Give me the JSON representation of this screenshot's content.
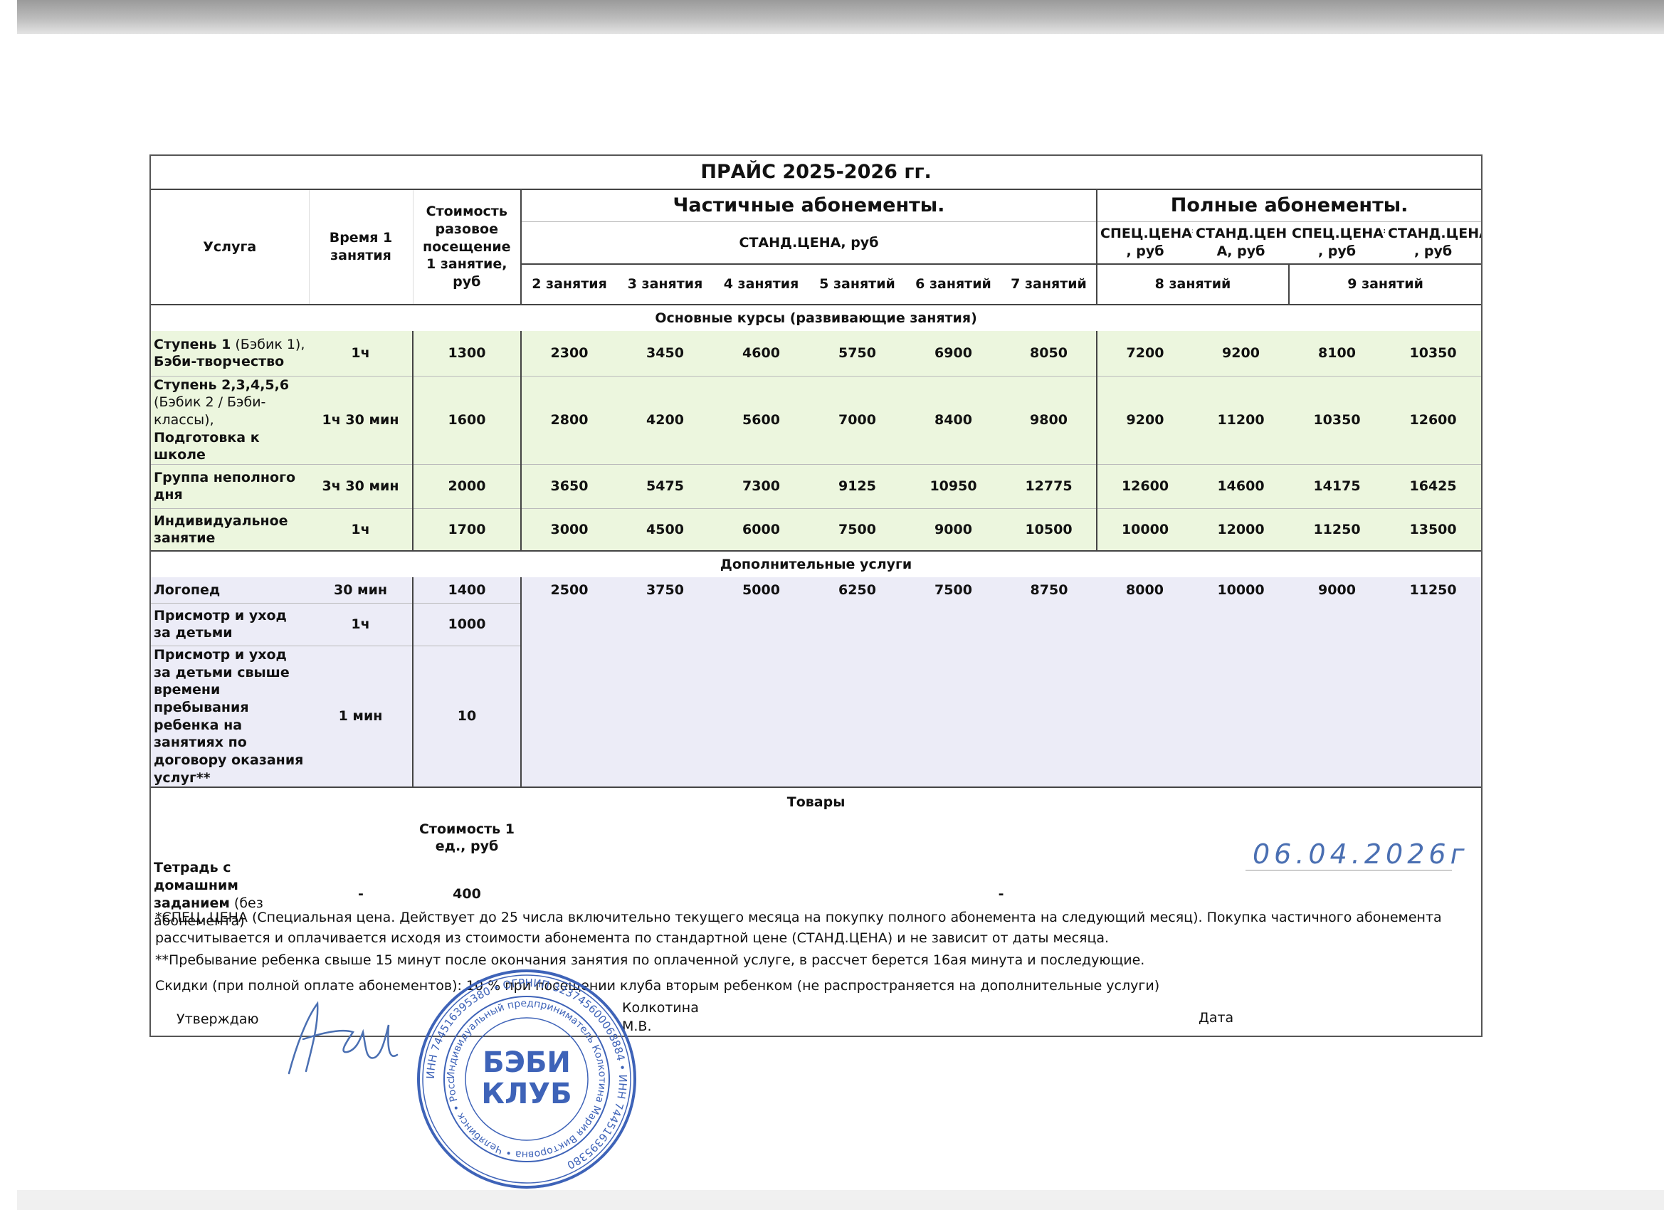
{
  "title": "ПРАЙС 2025-2026 гг.",
  "headers": {
    "service": "Услуга",
    "time": "Время 1 занятия",
    "single_cost": "Стоимость разовое посещение 1 занятие, руб",
    "partial_group": "Частичные абонементы.",
    "full_group": "Полные абонементы.",
    "std_price": "СТАНД.ЦЕНА, руб",
    "spec_8": "СПЕЦ.ЦЕНА* , руб",
    "std_8": "СТАНД.ЦЕН А, руб",
    "spec_9": "СПЕЦ.ЦЕНА* , руб",
    "std_9": "СТАНД.ЦЕНА , руб",
    "sessions": [
      "2 занятия",
      "3 занятия",
      "4 занятия",
      "5 занятий",
      "6 занятий",
      "7 занятий"
    ],
    "full_8": "8 занятий",
    "full_9": "9 занятий"
  },
  "sections": {
    "main": "Основные курсы (развивающие занятия)",
    "extra": "Дополнительные услуги",
    "goods": "Товары"
  },
  "main_rows": [
    {
      "name_bold": "Ступень 1",
      "name_normal": " (Бэбик 1),",
      "name_bold2": "Бэби-творчество",
      "time": "1ч",
      "single": "1300",
      "values": [
        "2300",
        "3450",
        "4600",
        "5750",
        "6900",
        "8050",
        "7200",
        "9200",
        "8100",
        "10350"
      ]
    },
    {
      "name_bold": "Ступень 2,3,4,5,6",
      "name_normal": "(Бэбик 2 / Бэби-классы),",
      "name_bold2": "Подготовка к школе",
      "time": "1ч 30 мин",
      "single": "1600",
      "values": [
        "2800",
        "4200",
        "5600",
        "7000",
        "8400",
        "9800",
        "9200",
        "11200",
        "10350",
        "12600"
      ]
    },
    {
      "name_bold": "Группа неполного дня",
      "name_normal": "",
      "name_bold2": "",
      "time": "3ч 30 мин",
      "single": "2000",
      "values": [
        "3650",
        "5475",
        "7300",
        "9125",
        "10950",
        "12775",
        "12600",
        "14600",
        "14175",
        "16425"
      ]
    },
    {
      "name_bold": "Индивидуальное занятие",
      "name_normal": "",
      "name_bold2": "",
      "time": "1ч",
      "single": "1700",
      "values": [
        "3000",
        "4500",
        "6000",
        "7500",
        "9000",
        "10500",
        "10000",
        "12000",
        "11250",
        "13500"
      ]
    }
  ],
  "extra_rows": [
    {
      "name": "Логопед",
      "time": "30 мин",
      "single": "1400",
      "values": [
        "2500",
        "3750",
        "5000",
        "6250",
        "7500",
        "8750",
        "8000",
        "10000",
        "9000",
        "11250"
      ]
    },
    {
      "name": "Присмотр и уход за детьми",
      "time": "1ч",
      "single": "1000",
      "values": []
    },
    {
      "name": "Присмотр и уход за детьми свыше времени пребывания ребенка на занятиях по договору оказания услуг**",
      "time": "1 мин",
      "single": "10",
      "values": []
    }
  ],
  "goods": {
    "cost_header": "Стоимость 1 ед., руб",
    "item_bold": "Тетрадь с домашним заданием",
    "item_normal": " (без абонемента)",
    "time": "-",
    "price": "400",
    "dash": "-"
  },
  "notes": {
    "spec_note": "*СПЕЦ. ЦЕНА  (Специальная цена. Действует до 25 числа включительно текущего месяца на покупку полного абонемента на следующий месяц). Покупка частичного абонемента рассчитывается и оплачивается исходя из стоимости абонемента по стандартной цене (СТАНД.ЦЕНА) и не зависит от даты месяца.",
    "stay_note": "**Пребывание ребенка свыше 15 минут после окончания занятия по оплаченной услуге, в рассчет берется 16ая минута и последующие.",
    "discount_note": "Скидки (при полной оплате абонементов): 10 % при посещении клуба вторым ребенком (не распространяется на дополнительные услуги)"
  },
  "signature": {
    "approve": "Утверждаю",
    "name_line1": "Колкотина",
    "name_line2": "М.В.",
    "date_label": "Дата",
    "date_value": "06.04.2026г"
  },
  "stamp": {
    "outer_text": "Индивидуальный предприниматель Колкотина Мария Викторовна",
    "city": "Челябинск",
    "country": "Россия",
    "logo_text": "БЭБИ КЛУБ",
    "ogrn": "ОГРНИП 323745600068884"
  },
  "colors": {
    "main_bg": "#ecf6de",
    "extra_bg": "#ececf7",
    "stamp_blue": "#3e63b8",
    "handwriting_blue": "#4a6fb2"
  }
}
